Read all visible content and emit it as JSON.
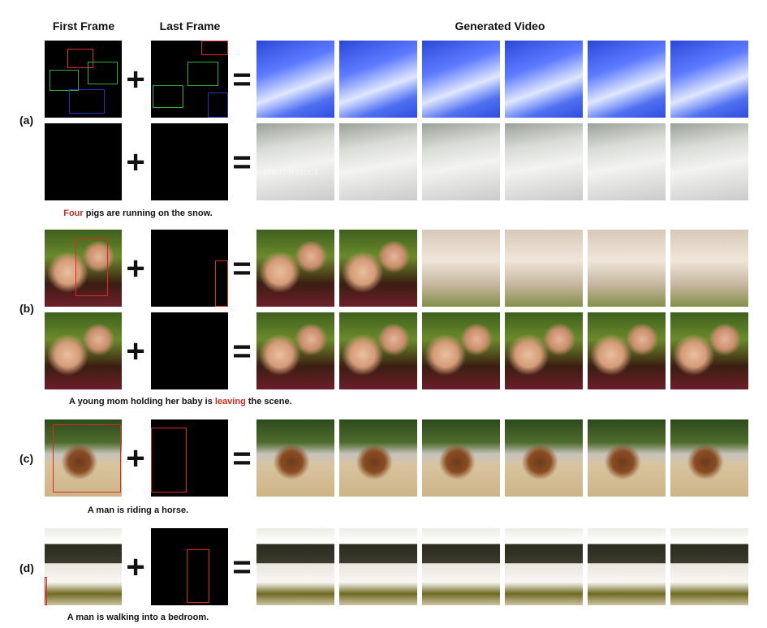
{
  "headers": {
    "first_frame": "First Frame",
    "last_frame": "Last Frame",
    "generated_video": "Generated Video"
  },
  "operators": {
    "plus": "+",
    "equals": "="
  },
  "rows": {
    "a": {
      "label": "(a)",
      "caption_highlight": "Four",
      "caption_rest": " pigs are running on the snow."
    },
    "b": {
      "label": "(b)",
      "caption_pre": "A young mom holding her baby is ",
      "caption_highlight": "leaving",
      "caption_post": " the scene."
    },
    "c": {
      "label": "(c)",
      "caption": "A man is riding a horse."
    },
    "d": {
      "label": "(d)",
      "caption": "A man is walking into a bedroom."
    }
  },
  "watermark": "shutterstock",
  "colors": {
    "highlight": "#d42a1e",
    "box_red": "#e0281e",
    "box_green": "#2fae2f",
    "box_blue": "#2433c8"
  }
}
